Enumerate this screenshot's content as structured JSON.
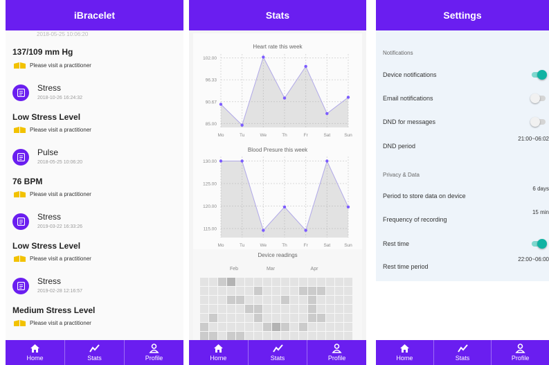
{
  "colors": {
    "primary": "#6a1ef0",
    "chart_point": "#7c5cff",
    "toggle_on": "#12b3a3"
  },
  "nav": [
    {
      "label": "Home",
      "icon": "home-icon"
    },
    {
      "label": "Stats",
      "icon": "stats-icon"
    },
    {
      "label": "Profile",
      "icon": "profile-icon"
    }
  ],
  "history": {
    "title": "iBracelet",
    "cut_timestamp": "2018-05-25 10:06:20",
    "top_reading": "137/109 mm Hg",
    "top_advice": "Please visit a practitioner",
    "entries": [
      {
        "title": "Stress",
        "time": "2018-10-26 16:24:32",
        "reading": "Low Stress Level",
        "advice": "Please visit a practitioner"
      },
      {
        "title": "Pulse",
        "time": "2018-05-25 10:06:20",
        "reading": "76 BPM",
        "advice": "Please visit a practitioner"
      },
      {
        "title": "Stress",
        "time": "2019-03-22 16:33:26",
        "reading": "Low Stress Level",
        "advice": "Please visit a practitioner"
      },
      {
        "title": "Stress",
        "time": "2019-02-28 12:16:57",
        "reading": "Medium Stress Level",
        "advice": "Please visit a practitioner"
      }
    ]
  },
  "stats": {
    "title": "Stats",
    "heatmap_months": [
      "Feb",
      "Mar",
      "Apr"
    ]
  },
  "chart_data": [
    {
      "type": "area",
      "title": "Heart rate this week",
      "categories": [
        "Mo",
        "Tu",
        "We",
        "Th",
        "Fr",
        "Sat",
        "Sun"
      ],
      "values": [
        90.0,
        84.6,
        102.2,
        91.6,
        99.8,
        87.6,
        91.8
      ],
      "yticks": [
        "102.00",
        "96.33",
        "90.67",
        "85.00"
      ],
      "ylim": [
        84,
        103
      ],
      "grid": true
    },
    {
      "type": "area",
      "title": "Blood Presure this week",
      "categories": [
        "Mo",
        "Tu",
        "We",
        "Th",
        "Fr",
        "Sat",
        "Sun"
      ],
      "values": [
        130.0,
        130.0,
        114.6,
        119.8,
        114.6,
        130.0,
        119.8
      ],
      "yticks": [
        "130.00",
        "125.00",
        "120.00",
        "115.00"
      ],
      "ylim": [
        113,
        131
      ],
      "grid": true
    },
    {
      "type": "heatmap",
      "title": "Device readings",
      "x": [
        "Feb",
        "Mar",
        "Apr"
      ],
      "rows": [
        [
          0,
          0,
          1,
          2,
          0,
          0,
          0,
          0,
          0,
          0,
          0,
          0,
          0,
          0,
          0,
          0,
          0
        ],
        [
          0,
          0,
          0,
          0,
          0,
          0,
          1,
          0,
          0,
          0,
          0,
          1,
          1,
          1,
          0,
          0,
          0
        ],
        [
          0,
          0,
          0,
          1,
          1,
          0,
          0,
          0,
          0,
          1,
          0,
          0,
          1,
          0,
          0,
          0,
          0
        ],
        [
          0,
          0,
          0,
          0,
          0,
          1,
          1,
          0,
          0,
          0,
          0,
          0,
          1,
          0,
          0,
          0,
          0
        ],
        [
          0,
          1,
          0,
          0,
          0,
          0,
          1,
          0,
          0,
          0,
          0,
          0,
          1,
          1,
          0,
          0,
          0
        ],
        [
          1,
          0,
          0,
          0,
          0,
          0,
          0,
          1,
          2,
          1,
          0,
          1,
          0,
          0,
          0,
          0,
          0
        ],
        [
          1,
          1,
          0,
          1,
          1,
          0,
          0,
          0,
          0,
          0,
          0,
          0,
          0,
          0,
          0,
          0,
          0
        ]
      ]
    }
  ],
  "settings": {
    "title": "Settings",
    "notifications_header": "Notifications",
    "privacy_header": "Privacy & Data",
    "device_notifications": {
      "label": "Device notifications",
      "on": true
    },
    "email_notifications": {
      "label": "Email notifications",
      "on": false
    },
    "dnd_messages": {
      "label": "DND for messages",
      "on": false
    },
    "dnd_period": {
      "label": "DND period",
      "value": "21:00~06:02"
    },
    "store_period": {
      "label": "Period to store data on device",
      "value": "6 days"
    },
    "recording_freq": {
      "label": "Frequency of recording",
      "value": "15 min"
    },
    "rest_time": {
      "label": "Rest time",
      "on": true
    },
    "rest_period": {
      "label": "Rest time period",
      "value": "22:00~06:00"
    }
  }
}
